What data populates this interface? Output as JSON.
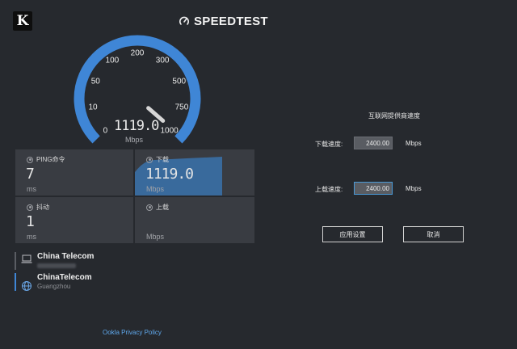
{
  "header": {
    "logo_text": "K",
    "brand": "SPEEDTEST"
  },
  "gauge": {
    "ticks": [
      "0",
      "10",
      "50",
      "100",
      "200",
      "300",
      "500",
      "750",
      "1000"
    ],
    "speed": "1119.0",
    "unit": "Mbps",
    "accent_color": "#3f86d6"
  },
  "stats": {
    "ping": {
      "label": "PING命令",
      "value": "7",
      "unit": "ms"
    },
    "download": {
      "label": "下载",
      "value": "1119.0",
      "unit": "Mbps"
    },
    "jitter": {
      "label": "抖动",
      "value": "1",
      "unit": "ms"
    },
    "upload": {
      "label": "上载",
      "value": "",
      "unit": "Mbps"
    }
  },
  "servers": [
    {
      "name": "China Telecom",
      "sub": "",
      "icon": "laptop-icon"
    },
    {
      "name": "ChinaTelecom",
      "sub": "Guangzhou",
      "icon": "globe-icon"
    }
  ],
  "footer": {
    "privacy": "Ookla Privacy Policy"
  },
  "settings": {
    "title": "互联网提供商速度",
    "download_label": "下载速度:",
    "download_value": "2400.00",
    "upload_label": "上载速度:",
    "upload_value": "2400.00",
    "unit": "Mbps",
    "apply": "应用设置",
    "cancel": "取消"
  }
}
